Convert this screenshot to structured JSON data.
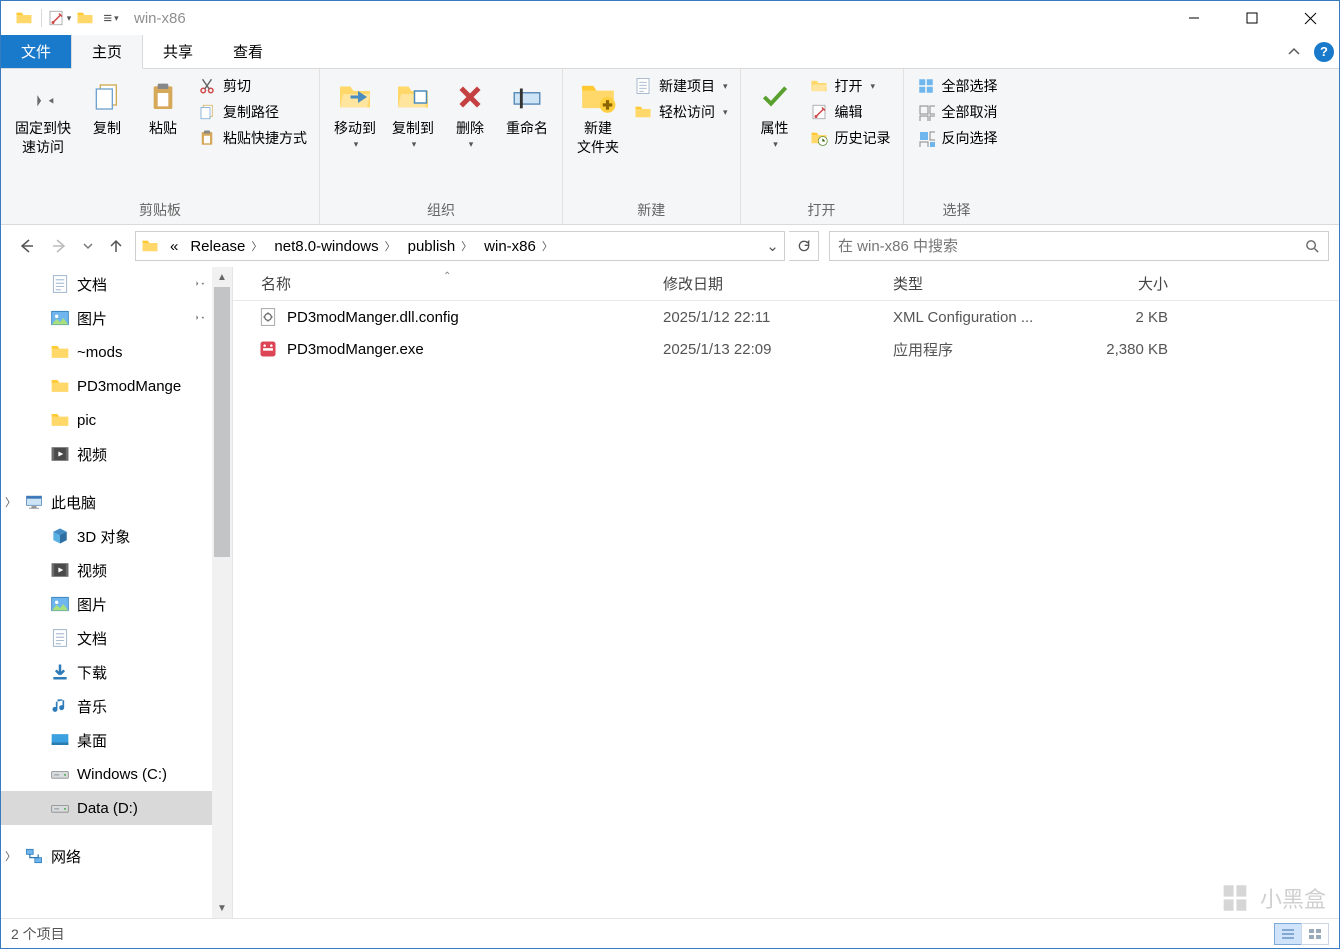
{
  "title": "win-x86",
  "tabs": {
    "file": "文件",
    "home": "主页",
    "share": "共享",
    "view": "查看"
  },
  "ribbon": {
    "clipboard": {
      "pin": "固定到快\n速访问",
      "copy": "复制",
      "paste": "粘贴",
      "cut": "剪切",
      "copypath": "复制路径",
      "pasteshortcut": "粘贴快捷方式",
      "group": "剪贴板"
    },
    "organize": {
      "moveto": "移动到",
      "copyto": "复制到",
      "delete": "删除",
      "rename": "重命名",
      "group": "组织"
    },
    "new": {
      "newfolder": "新建\n文件夹",
      "newitem": "新建项目",
      "easyaccess": "轻松访问",
      "group": "新建"
    },
    "open": {
      "properties": "属性",
      "open": "打开",
      "edit": "编辑",
      "history": "历史记录",
      "group": "打开"
    },
    "select": {
      "selectall": "全部选择",
      "selectnone": "全部取消",
      "invert": "反向选择",
      "group": "选择"
    }
  },
  "breadcrumbs": [
    {
      "label": "«",
      "chev": false
    },
    {
      "label": "Release",
      "chev": true
    },
    {
      "label": "net8.0-windows",
      "chev": true
    },
    {
      "label": "publish",
      "chev": true
    },
    {
      "label": "win-x86",
      "chev": true
    }
  ],
  "search_placeholder": "在 win-x86 中搜索",
  "sidebar": [
    {
      "indent": 48,
      "icon": "doc",
      "label": "文档",
      "pin": true
    },
    {
      "indent": 48,
      "icon": "pic",
      "label": "图片",
      "pin": true
    },
    {
      "indent": 48,
      "icon": "folder",
      "label": "~mods"
    },
    {
      "indent": 48,
      "icon": "folder",
      "label": "PD3modMange"
    },
    {
      "indent": 48,
      "icon": "folder",
      "label": "pic"
    },
    {
      "indent": 48,
      "icon": "video",
      "label": "视频"
    },
    {
      "spacer": true
    },
    {
      "indent": 22,
      "icon": "pc",
      "label": "此电脑",
      "expand": true
    },
    {
      "indent": 48,
      "icon": "obj3d",
      "label": "3D 对象"
    },
    {
      "indent": 48,
      "icon": "video",
      "label": "视频"
    },
    {
      "indent": 48,
      "icon": "pic",
      "label": "图片"
    },
    {
      "indent": 48,
      "icon": "doc",
      "label": "文档"
    },
    {
      "indent": 48,
      "icon": "down",
      "label": "下载"
    },
    {
      "indent": 48,
      "icon": "music",
      "label": "音乐"
    },
    {
      "indent": 48,
      "icon": "desk",
      "label": "桌面"
    },
    {
      "indent": 48,
      "icon": "drive",
      "label": "Windows (C:)"
    },
    {
      "indent": 48,
      "icon": "drive",
      "label": "Data (D:)",
      "selected": true
    },
    {
      "spacer": true
    },
    {
      "indent": 22,
      "icon": "net",
      "label": "网络",
      "expand": true
    }
  ],
  "columns": {
    "name": "名称",
    "date": "修改日期",
    "type": "类型",
    "size": "大小"
  },
  "files": [
    {
      "icon": "config",
      "name": "PD3modManger.dll.config",
      "date": "2025/1/12 22:11",
      "type": "XML Configuration ...",
      "size": "2 KB"
    },
    {
      "icon": "exe",
      "name": "PD3modManger.exe",
      "date": "2025/1/13 22:09",
      "type": "应用程序",
      "size": "2,380 KB"
    }
  ],
  "status": "2 个项目",
  "watermark": "小黑盒",
  "help": "?"
}
